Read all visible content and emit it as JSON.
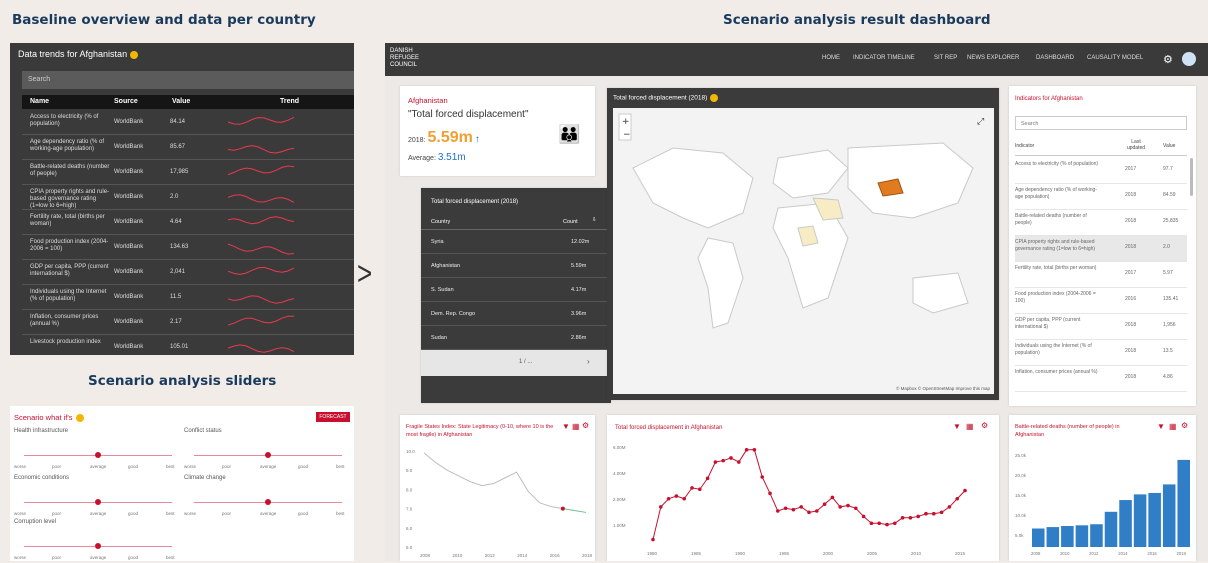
{
  "headings": {
    "baseline": "Baseline overview and data per country",
    "dashboard": "Scenario analysis result dashboard",
    "sliders": "Scenario analysis sliders"
  },
  "baseline": {
    "title": "Data trends for Afghanistan",
    "search_placeholder": "Search",
    "columns": [
      "Name",
      "Source",
      "Value",
      "Trend"
    ],
    "rows": [
      {
        "name": "Access to electricity (% of population)",
        "source": "WorldBank",
        "value": "84.14"
      },
      {
        "name": "Age dependency ratio (% of working-age population)",
        "source": "WorldBank",
        "value": "85.67"
      },
      {
        "name": "Battle-related deaths (number of people)",
        "source": "WorldBank",
        "value": "17,985"
      },
      {
        "name": "CPIA property rights and rule-based governance rating (1=low to 6=high)",
        "source": "WorldBank",
        "value": "2.0"
      },
      {
        "name": "Fertility rate, total (births per woman)",
        "source": "WorldBank",
        "value": "4.64"
      },
      {
        "name": "Food production index (2004-2006 = 100)",
        "source": "WorldBank",
        "value": "134.63"
      },
      {
        "name": "GDP per capita, PPP (current international $)",
        "source": "WorldBank",
        "value": "2,041"
      },
      {
        "name": "Individuals using the Internet (% of population)",
        "source": "WorldBank",
        "value": "11.5"
      },
      {
        "name": "Inflation, consumer prices (annual %)",
        "source": "WorldBank",
        "value": "2.17"
      },
      {
        "name": "Livestock production index",
        "source": "WorldBank",
        "value": "105.01"
      }
    ]
  },
  "sliders": {
    "title": "Scenario what if's",
    "forecast_label": "FORECAST",
    "tick_labels": [
      "worse",
      "poor",
      "average",
      "good",
      "best"
    ],
    "groups": [
      {
        "label": "Health infrastructure",
        "level": 0.5
      },
      {
        "label": "Conflict status",
        "level": 0.5
      },
      {
        "label": "Economic conditions",
        "level": 0.5
      },
      {
        "label": "Climate change",
        "level": 0.5
      },
      {
        "label": "Corruption level",
        "level": 0.5
      }
    ]
  },
  "dashboard": {
    "logo_lines": [
      "DANISH",
      "REFUGEE",
      "COUNCIL"
    ],
    "nav": [
      "HOME",
      "INDICATOR TIMELINE",
      "SIT REP",
      "NEWS EXPLORER",
      "DASHBOARD",
      "CAUSALITY MODEL"
    ],
    "summary": {
      "country": "Afghanistan",
      "indicator": "\"Total forced displacement\"",
      "year_label": "2018:",
      "value": "5.59m",
      "trend_arrow": "↑",
      "avg_label": "Average:",
      "avg_value": "3.51m"
    },
    "map_title": "Total forced displacement (2018)",
    "map_credit": "© Mapbox © OpenStreetMap Improve this map",
    "country_table": {
      "title": "Total forced displacement (2018)",
      "columns": [
        "Country",
        "Count"
      ],
      "rows": [
        {
          "country": "Syria",
          "count": "12.02m"
        },
        {
          "country": "Afghanistan",
          "count": "5.59m"
        },
        {
          "country": "S. Sudan",
          "count": "4.17m"
        },
        {
          "country": "Dem. Rep. Congo",
          "count": "3.96m"
        },
        {
          "country": "Sudan",
          "count": "2.86m"
        }
      ],
      "page": "1 / ..."
    },
    "indicators": {
      "title": "Indicators for Afghanistan",
      "search_placeholder": "Search",
      "columns": [
        "Indicator",
        "Last updated",
        "Value"
      ],
      "rows": [
        {
          "name": "Access to electricity (% of population)",
          "year": "2017",
          "value": "97.7"
        },
        {
          "name": "Age dependency ratio (% of working-age population)",
          "year": "2018",
          "value": "84.59"
        },
        {
          "name": "Battle-related deaths (number of people)",
          "year": "2018",
          "value": "25,835"
        },
        {
          "name": "CPIA property rights and rule-based governance rating (1=low to 6=high)",
          "year": "2018",
          "value": "2.0"
        },
        {
          "name": "Fertility rate, total (births per woman)",
          "year": "2017",
          "value": "5.97"
        },
        {
          "name": "Food production index (2004-2006 = 100)",
          "year": "2016",
          "value": "135.41"
        },
        {
          "name": "GDP per capita, PPP (current international $)",
          "year": "2018",
          "value": "1,956"
        },
        {
          "name": "Individuals using the Internet (% of population)",
          "year": "2018",
          "value": "13.5"
        },
        {
          "name": "Inflation, consumer prices (annual %)",
          "year": "2018",
          "value": "4.86"
        }
      ]
    },
    "chart1_title": "Fragile States Index: State Legitimacy (0-10, where 10 is the most fragile) in Afghanistan",
    "chart2_title": "Total forced displacement in Afghanistan",
    "chart3_title": "Battle-related deaths (number of people) in Afghanistan"
  },
  "chart_data": [
    {
      "type": "line",
      "title": "Fragile States Index: State Legitimacy (0-10, where 10 is the most fragile) in Afghanistan",
      "x": [
        2006,
        2007,
        2008,
        2009,
        2010,
        2011,
        2012,
        2013,
        2014,
        2015,
        2016,
        2017,
        2018,
        2019,
        2020
      ],
      "values": [
        9.9,
        9.4,
        9.0,
        8.7,
        8.4,
        8.2,
        8.3,
        8.6,
        8.9,
        7.9,
        7.3,
        7.1,
        7.0,
        6.9,
        6.8
      ],
      "yticks": [
        "10.0",
        "9.0",
        "8.0",
        "7.0",
        "6.0",
        "5.0"
      ],
      "xticks": [
        "2008",
        "2010",
        "2012",
        "2014",
        "2016",
        "2018"
      ]
    },
    {
      "type": "line",
      "title": "Total forced displacement in Afghanistan",
      "values": [
        0.4,
        2.8,
        3.4,
        3.6,
        3.4,
        4.2,
        4.1,
        4.9,
        6.1,
        6.2,
        6.4,
        6.1,
        7.0,
        7.0,
        5.0,
        3.8,
        2.5,
        2.7,
        2.6,
        2.8,
        2.4,
        2.5,
        3.0,
        3.5,
        2.8,
        2.9,
        2.7,
        2.1,
        1.6,
        1.6,
        1.5,
        1.6,
        2.0,
        2.0,
        2.1,
        2.3,
        2.3,
        2.4,
        2.8,
        3.4,
        4.0
      ],
      "yticks": [
        "6.00M",
        "4.00M",
        "2.00M",
        "1.00M"
      ],
      "xticks": [
        "1980",
        "1985",
        "1990",
        "1995",
        "2000",
        "2005",
        "2010",
        "2015"
      ]
    },
    {
      "type": "bar",
      "title": "Battle-related deaths (number of people) in Afghanistan",
      "categories": [
        "2008",
        "2009",
        "2010",
        "2011",
        "2012",
        "2013",
        "2014",
        "2015",
        "2016",
        "2017",
        "2018"
      ],
      "values": [
        5.2,
        5.6,
        5.9,
        6.1,
        6.4,
        9.9,
        13.2,
        14.8,
        15.2,
        17.6,
        24.5
      ],
      "yticks": [
        "25.0k",
        "20.0k",
        "15.0k",
        "10.0k",
        "5.0k"
      ]
    }
  ]
}
